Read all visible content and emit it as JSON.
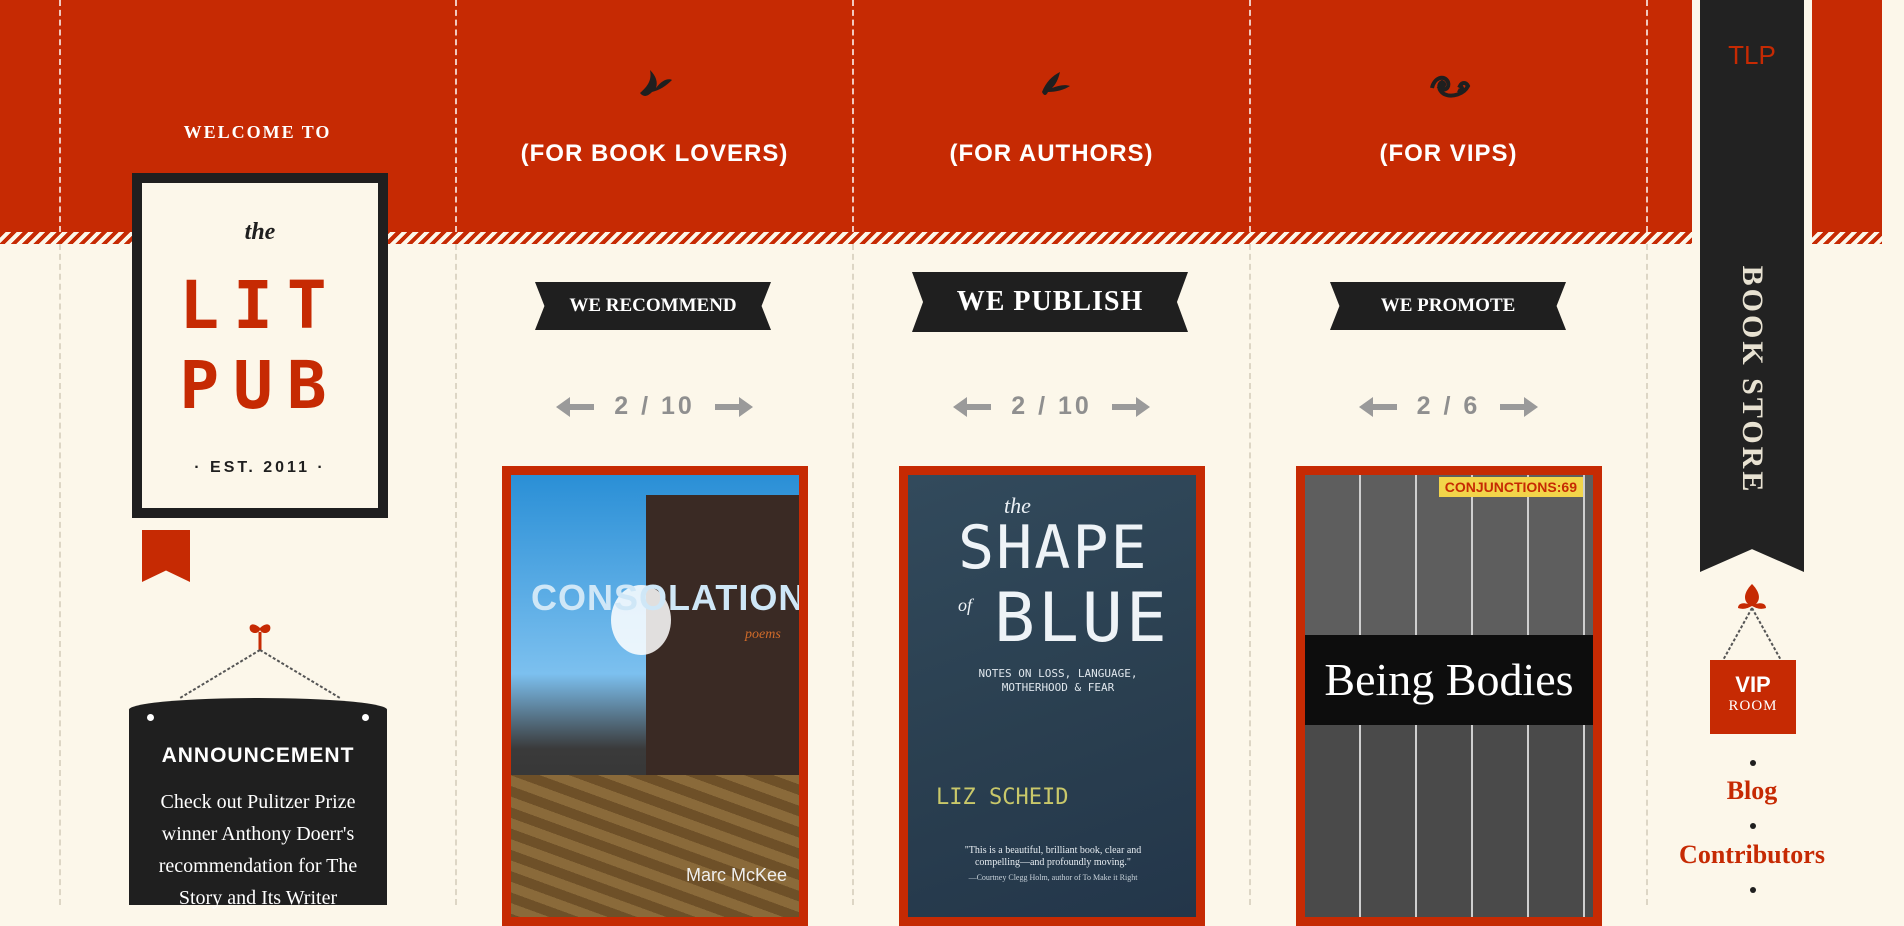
{
  "welcome": "WELCOME TO",
  "logo": {
    "the": "the",
    "line1": "LIT",
    "line2": "PUB",
    "est": "· EST. 2011 ·"
  },
  "announcement": {
    "title": "ANNOUNCEMENT",
    "text": "Check out Pulitzer Prize winner Anthony Doerr's recommendation for The Story and Its Writer"
  },
  "columns": [
    {
      "heading": "(FOR BOOK LOVERS)",
      "ribbon": "WE RECOMMEND",
      "page": "2 / 10",
      "book": {
        "title": "CONSOLATIONEER",
        "subtitle": "poems",
        "author": "Marc McKee"
      }
    },
    {
      "heading": "(FOR AUTHORS)",
      "ribbon": "WE PUBLISH",
      "page": "2 / 10",
      "book": {
        "title_small": "the",
        "title_line1": "SHAPE",
        "title_of": "of",
        "title_line2": "BLUE",
        "subtitle": "NOTES ON LOSS, LANGUAGE, MOTHERHOOD & FEAR",
        "author": "LIZ SCHEID",
        "blurb": "\"This is a beautiful, brilliant book, clear and compelling—and profoundly moving.\"",
        "blurb_by": "—Courtney Clegg Holm, author of To Make it Right"
      }
    },
    {
      "heading": "(FOR VIPS)",
      "ribbon": "WE PROMOTE",
      "page": "2 / 6",
      "book": {
        "badge": "CONJUNCTIONS:69",
        "title": "Being Bodies"
      }
    }
  ],
  "sidebar": {
    "tlp": "TLP",
    "bookstore": "BOOK STORE",
    "vip_big": "VIP",
    "vip_small": "ROOM",
    "links": [
      "Blog",
      "Contributors"
    ]
  },
  "colors": {
    "accent": "#c62a03",
    "dark": "#1f1f1f",
    "background": "#fcf7ea"
  }
}
